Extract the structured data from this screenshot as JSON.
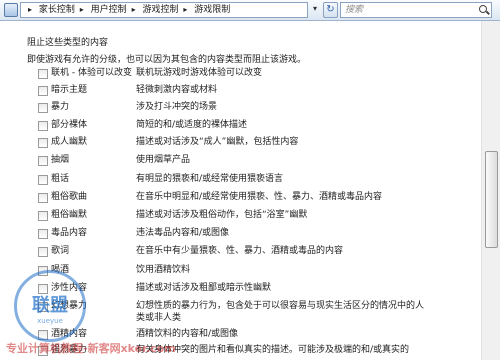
{
  "breadcrumb": [
    "家长控制",
    "用户控制",
    "游戏控制",
    "游戏限制"
  ],
  "search": {
    "placeholder": "搜索"
  },
  "section": {
    "title": "阻止这些类型的内容",
    "description": "即使游戏有允许的分级，也可以因为其包含的内容类型而阻止该游戏。"
  },
  "content_rows": [
    {
      "label": "联机 - 体验可以改变",
      "description": "联机玩游戏时游戏体验可以改变",
      "checked": false
    },
    {
      "label": "暗示主题",
      "description": "轻微刺激内容或材料",
      "checked": false
    },
    {
      "label": "暴力",
      "description": "涉及打斗冲突的场景",
      "checked": false
    },
    {
      "label": "部分裸体",
      "description": "简短的和/或适度的裸体描述",
      "checked": false
    },
    {
      "label": "成人幽默",
      "description": "描述或对话涉及“成人”幽默，包括性内容",
      "checked": false
    },
    {
      "label": "抽烟",
      "description": "使用烟草产品",
      "checked": false
    },
    {
      "label": "粗话",
      "description": "有明显的猥亵和/或经常使用猥亵语言",
      "checked": false
    },
    {
      "label": "粗俗歌曲",
      "description": "在音乐中明显和/或经常使用猥亵、性、暴力、酒精或毒品内容",
      "checked": false
    },
    {
      "label": "粗俗幽默",
      "description": "描述或对话涉及粗俗动作，包括“浴室”幽默",
      "checked": false
    },
    {
      "label": "毒品内容",
      "description": "违法毒品内容和/或图像",
      "checked": false
    },
    {
      "label": "歌词",
      "description": "在音乐中有少量猥亵、性、暴力、酒精或毒品的内容",
      "checked": false
    },
    {
      "label": "喝酒",
      "description": "饮用酒精饮料",
      "checked": false
    },
    {
      "label": "涉性内容",
      "description": "描述或对话涉及粗鄙或暗示性幽默",
      "checked": false
    },
    {
      "label": "幻想暴力",
      "description": "幻想性质的暴力行为，包含处于可以很容易与现实生活区分的情况中的人类或非人类",
      "checked": false
    },
    {
      "label": "酒精内容",
      "description": "酒精饮料的内容和/或图像",
      "checked": false
    },
    {
      "label": "强烈暴力",
      "description": "有关身体冲突的图片和看似真实的描述。可能涉及极端的和/或真实的",
      "checked": false
    }
  ],
  "watermarks": {
    "seal": "联盟",
    "seal_sub": "xueyue",
    "bottom": "专业计算机教程-新客网xker.com"
  },
  "colors": {
    "topbar": "#dbe6f2",
    "checkbox_border": "#9a9a9a"
  }
}
